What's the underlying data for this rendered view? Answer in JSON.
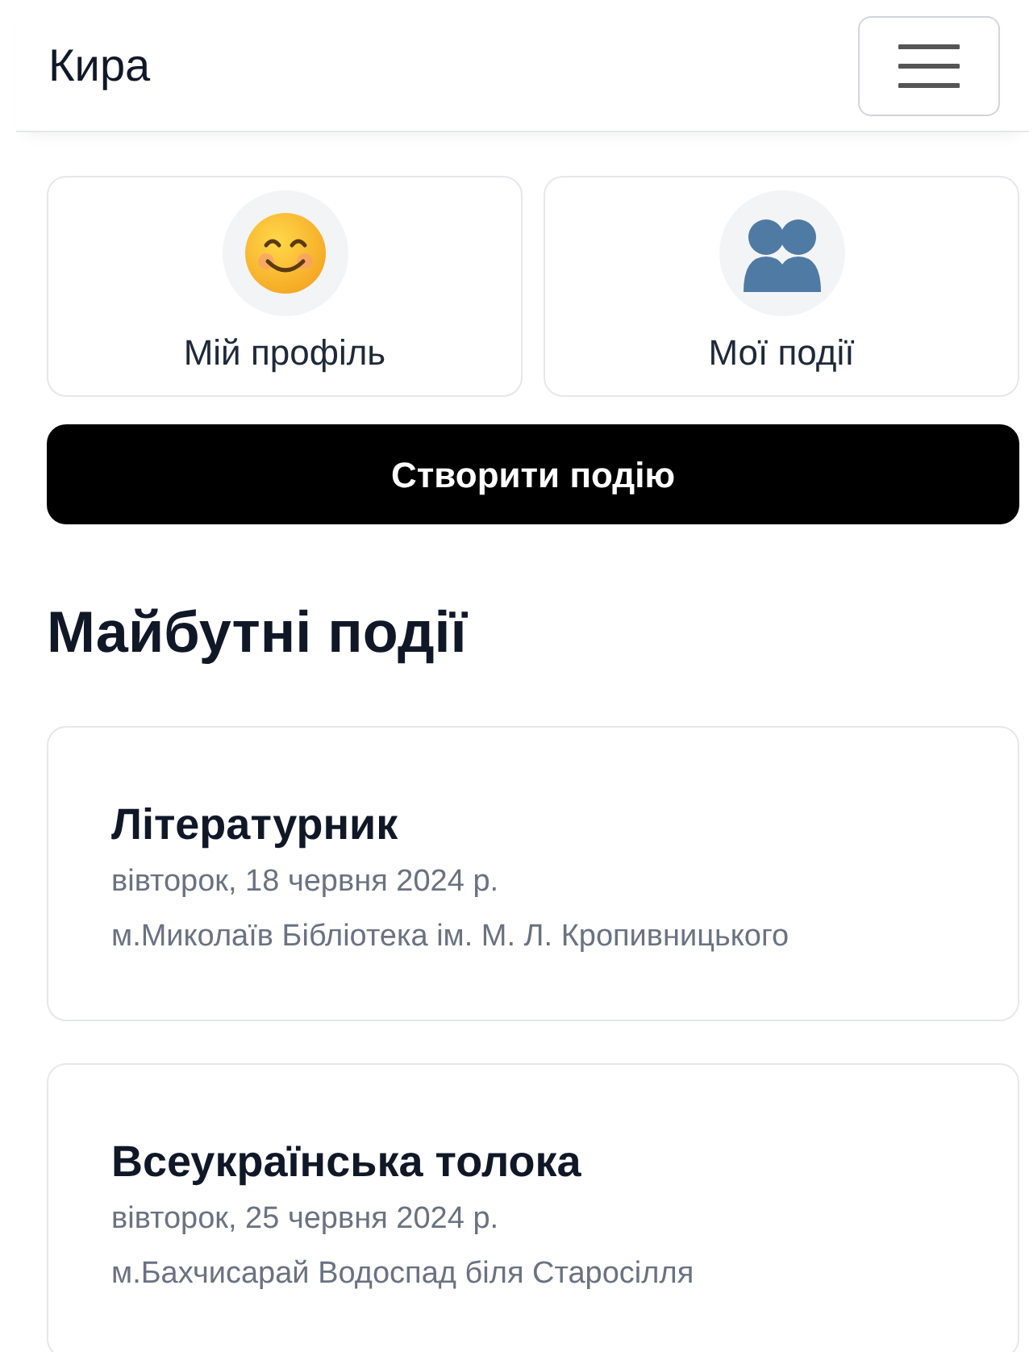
{
  "navbar": {
    "brand": "Кира"
  },
  "tiles": [
    {
      "kind": "smiley",
      "label": "Мій профіль"
    },
    {
      "kind": "people",
      "label": "Мої події"
    }
  ],
  "create_button": "Створити подію",
  "section_title": "Майбутні події",
  "events": [
    {
      "title": "Літературник",
      "date": "вівторок, 18 червня 2024 р.",
      "place": "м.Миколаїв Бібліотека ім. М. Л. Кропивницького"
    },
    {
      "title": "Всеукраїнська толока",
      "date": "вівторок, 25 червня 2024 р.",
      "place": "м.Бахчисарай Водоспад біля Старосілля"
    }
  ]
}
